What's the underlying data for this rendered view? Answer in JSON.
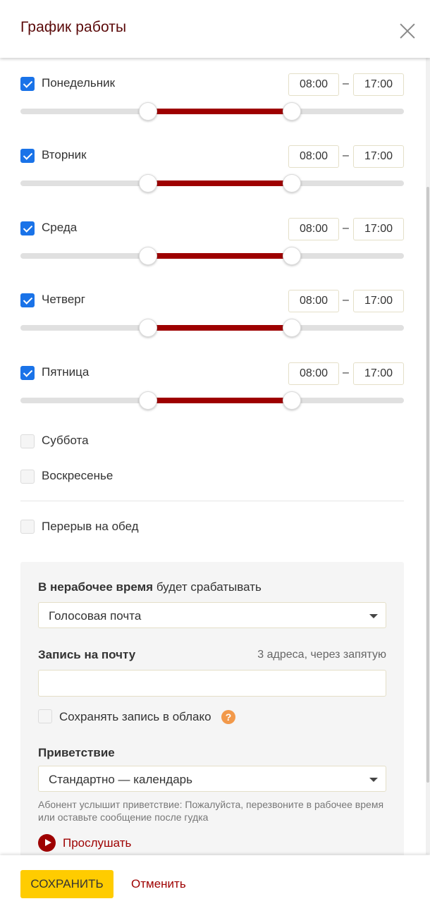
{
  "header": {
    "title": "График работы"
  },
  "days": [
    {
      "label": "Понедельник",
      "checked": true,
      "from": "08:00",
      "to": "17:00",
      "range_start_hours": 8,
      "range_end_hours": 17,
      "scale_max_hours": 24
    },
    {
      "label": "Вторник",
      "checked": true,
      "from": "08:00",
      "to": "17:00",
      "range_start_hours": 8,
      "range_end_hours": 17,
      "scale_max_hours": 24
    },
    {
      "label": "Среда",
      "checked": true,
      "from": "08:00",
      "to": "17:00",
      "range_start_hours": 8,
      "range_end_hours": 17,
      "scale_max_hours": 24
    },
    {
      "label": "Четверг",
      "checked": true,
      "from": "08:00",
      "to": "17:00",
      "range_start_hours": 8,
      "range_end_hours": 17,
      "scale_max_hours": 24
    },
    {
      "label": "Пятница",
      "checked": true,
      "from": "08:00",
      "to": "17:00",
      "range_start_hours": 8,
      "range_end_hours": 17,
      "scale_max_hours": 24
    },
    {
      "label": "Суббота",
      "checked": false
    },
    {
      "label": "Воскресенье",
      "checked": false
    }
  ],
  "time_separator": "–",
  "lunch": {
    "label": "Перерыв на обед",
    "checked": false
  },
  "offhours": {
    "heading_bold": "В нерабочее время",
    "heading_rest": " будет срабатывать",
    "action_value": "Голосовая почта",
    "email_label": "Запись на почту",
    "email_hint": "3 адреса, через запятую",
    "email_value": "",
    "cloud_label": "Сохранять запись в облако",
    "cloud_checked": false,
    "help_symbol": "?",
    "greeting_label": "Приветствие",
    "greeting_value": "Стандартно — календарь",
    "greeting_note": "Абонент услышит приветствие: Пожалуйста, перезвоните в рабочее время или оставьте сообщение после гудка",
    "listen_label": "Прослушать"
  },
  "footer": {
    "save_label": "СОХРАНИТЬ",
    "cancel_label": "Отменить"
  },
  "colors": {
    "accent": "#9e0000",
    "checkbox": "#1a73e8",
    "save_button": "#ffcc00",
    "title": "#5b0a0a"
  }
}
